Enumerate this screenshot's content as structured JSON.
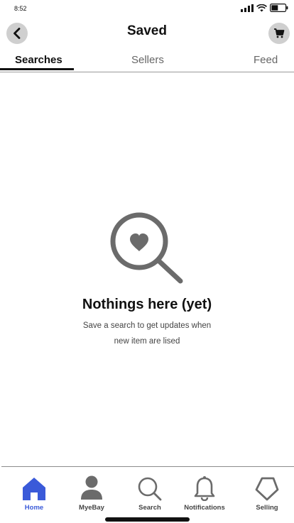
{
  "status_bar": {
    "time": "8:52"
  },
  "header": {
    "title": "Saved",
    "back_icon": "chevron-left-icon",
    "cart_icon": "cart-icon"
  },
  "tabs": [
    {
      "label": "Searches",
      "active": true
    },
    {
      "label": "Sellers",
      "active": false
    },
    {
      "label": "Feed",
      "active": false
    }
  ],
  "empty_state": {
    "icon": "search-heart-icon",
    "title": "Nothings here (yet)",
    "description": "Save a search to get updates when new item are lised"
  },
  "bottom_nav": [
    {
      "label": "Home",
      "icon": "home-icon",
      "active": true
    },
    {
      "label": "MyeBay",
      "icon": "user-icon",
      "active": false
    },
    {
      "label": "Search",
      "icon": "search-icon",
      "active": false
    },
    {
      "label": "Notifications",
      "icon": "bell-icon",
      "active": false
    },
    {
      "label": "Selling",
      "icon": "tag-icon",
      "active": false
    }
  ],
  "colors": {
    "accent": "#3a5ad9",
    "icon_gray": "#6b6b6b",
    "button_bg": "#cfcfcf"
  }
}
